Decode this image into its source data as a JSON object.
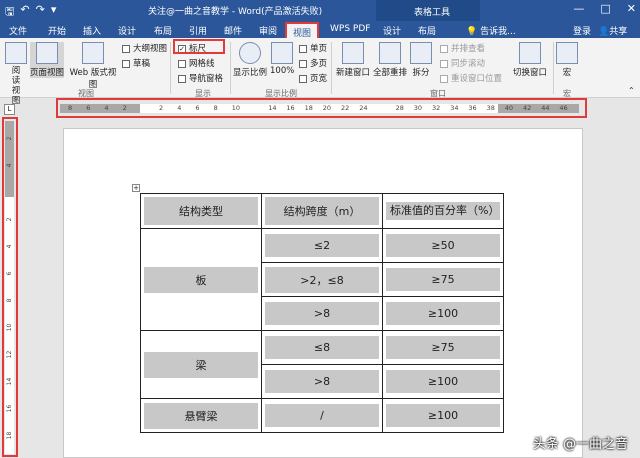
{
  "titlebar": {
    "title": "关注@一曲之音教学 - Word(产品激活失败)",
    "context_tab_group": "表格工具",
    "minimize": "—",
    "restore": "□",
    "close": "✕"
  },
  "tabs": [
    "文件",
    "开始",
    "插入",
    "设计",
    "布局",
    "引用",
    "邮件",
    "审阅",
    "视图",
    "WPS PDF",
    "设计",
    "布局"
  ],
  "tell_me": "告诉我...",
  "login": "登录",
  "share": "共享",
  "ribbon": {
    "views": {
      "read": "阅读视图",
      "print": "页面视图",
      "web": "Web 版式视图",
      "outline": "大纲视图",
      "draft": "草稿",
      "group": "视图"
    },
    "show": {
      "ruler": "标尺",
      "gridlines": "网格线",
      "nav": "导航窗格",
      "group": "显示"
    },
    "zoom": {
      "zoom": "显示比例",
      "hundred": "100%",
      "one": "单页",
      "multi": "多页",
      "width": "页宽",
      "group": "显示比例"
    },
    "window": {
      "new": "新建窗口",
      "arrange": "全部重排",
      "split": "拆分",
      "side": "并排查看",
      "sync": "同步滚动",
      "reset": "重设窗口位置",
      "switch": "切换窗口",
      "group": "窗口"
    },
    "macros": {
      "label": "宏",
      "group": "宏"
    }
  },
  "ruler_ticks": [
    "8",
    "6",
    "4",
    "2",
    "",
    "2",
    "4",
    "6",
    "8",
    "10",
    "",
    "14",
    "16",
    "18",
    "20",
    "22",
    "24",
    "",
    "28",
    "30",
    "32",
    "34",
    "36",
    "38",
    "40",
    "42",
    "44",
    "46"
  ],
  "vruler_ticks": [
    "2",
    "4",
    "",
    "2",
    "4",
    "6",
    "8",
    "10",
    "12",
    "14",
    "16",
    "18"
  ],
  "table": {
    "headers": [
      "结构类型",
      "结构跨度（m）",
      "标准值的百分率（%）"
    ],
    "rows": [
      {
        "type": "板",
        "span": "≤2",
        "pct": "≥50"
      },
      {
        "type": "",
        "span": ">2，≤8",
        "pct": "≥75"
      },
      {
        "type": "",
        "span": ">8",
        "pct": "≥100"
      },
      {
        "type": "梁",
        "span": "≤8",
        "pct": "≥75"
      },
      {
        "type": "",
        "span": ">8",
        "pct": "≥100"
      },
      {
        "type": "悬臂梁",
        "span": "/",
        "pct": "≥100"
      }
    ]
  },
  "watermark": "头条 @一曲之音"
}
